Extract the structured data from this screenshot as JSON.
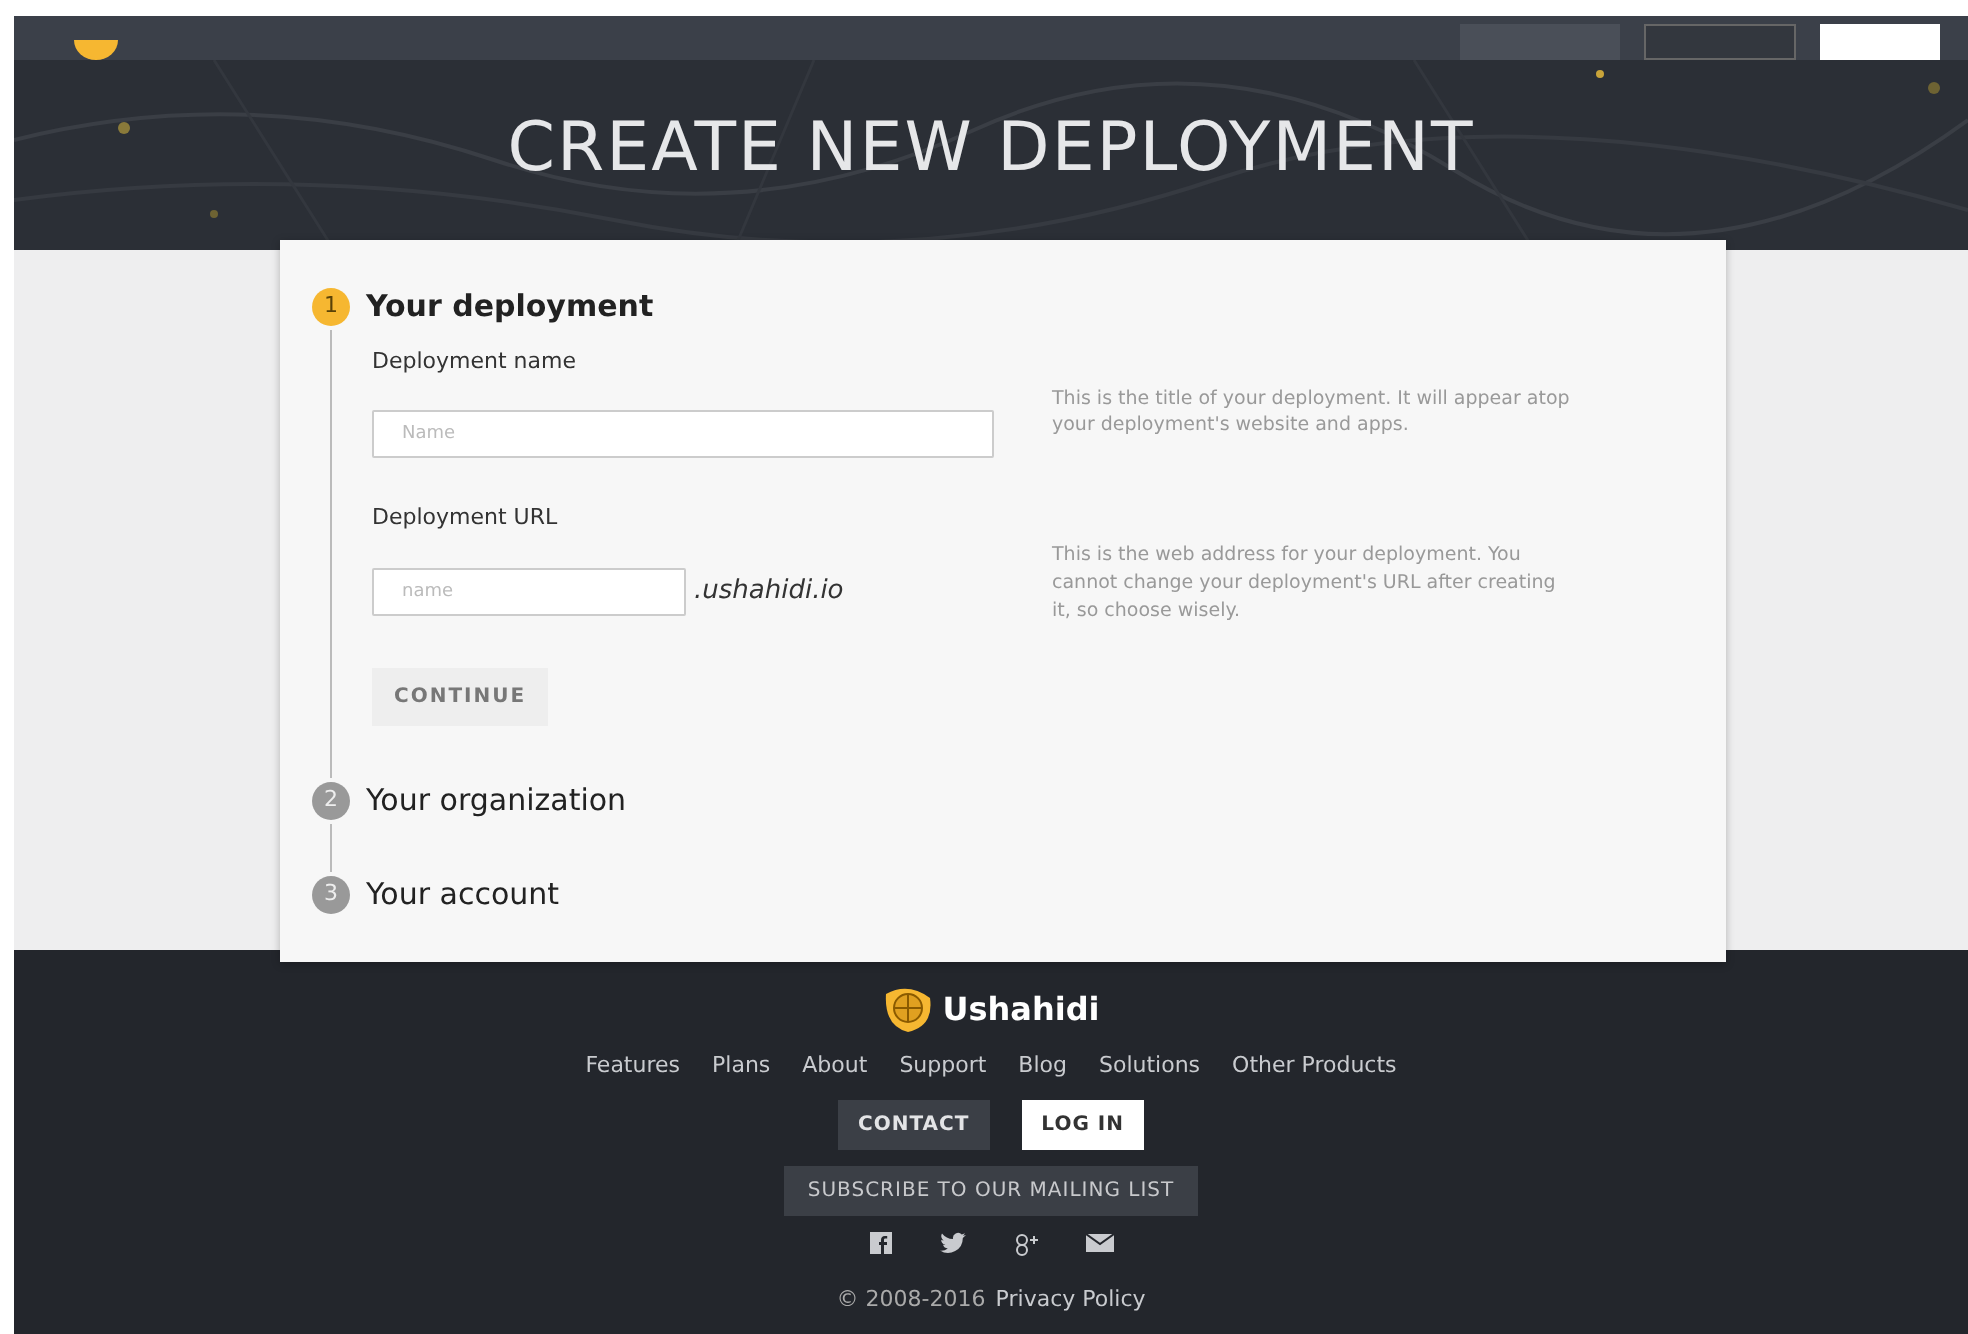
{
  "hero": {
    "title": "CREATE NEW DEPLOYMENT"
  },
  "steps": [
    {
      "number": "1",
      "title": "Your deployment",
      "selected": true
    },
    {
      "number": "2",
      "title": "Your organization",
      "selected": false
    },
    {
      "number": "3",
      "title": "Your account",
      "selected": false
    }
  ],
  "form": {
    "fields": [
      {
        "label": "Deployment name",
        "placeholder": "Name",
        "help": "This is the title of your deployment. It will appear atop your deployment's website and apps."
      },
      {
        "label": "Deployment URL",
        "placeholder": "name",
        "suffix": ".ushahidi.io",
        "help": "This is the web address for your deployment. You cannot change your deployment's URL after creating it, so choose wisely."
      }
    ],
    "button": "CONTINUE"
  },
  "footer": {
    "brand": "Ushahidi",
    "links": [
      "Features",
      "Plans",
      "About",
      "Support",
      "Blog",
      "Solutions",
      "Other Products"
    ],
    "buttons": [
      {
        "label": "CONTACT",
        "kind": "dark"
      },
      {
        "label": "LOG IN",
        "kind": "light"
      }
    ],
    "subscribe": "SUBSCRIBE TO OUR MAILING LIST",
    "copyright": "© 2008-2016",
    "policy": "Privacy Policy"
  }
}
